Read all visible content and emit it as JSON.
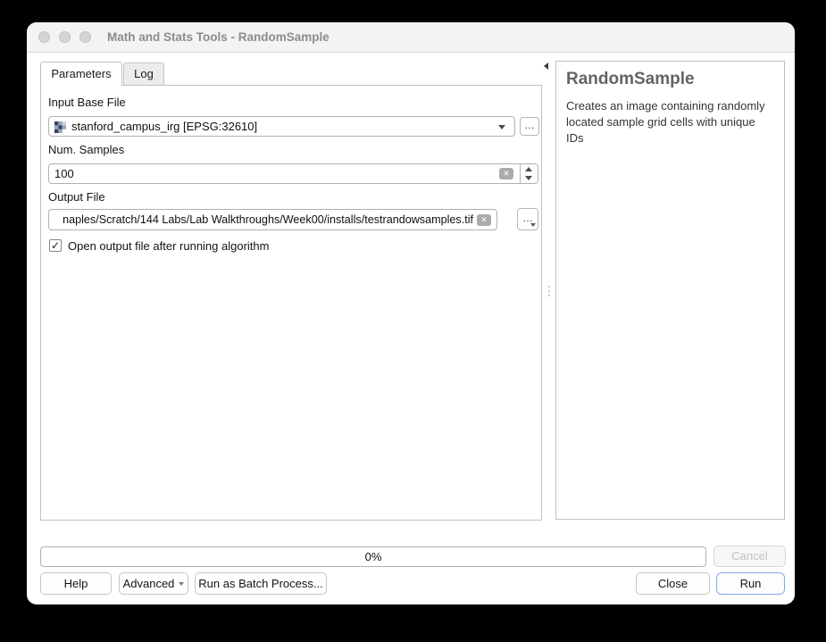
{
  "window": {
    "title": "Math and Stats Tools - RandomSample"
  },
  "tabs": {
    "parameters": "Parameters",
    "log": "Log"
  },
  "form": {
    "input_base_file": {
      "label": "Input Base File",
      "value": "stanford_campus_irg [EPSG:32610]",
      "icon": "raster-layer-icon"
    },
    "num_samples": {
      "label": "Num. Samples",
      "value": "100"
    },
    "output_file": {
      "label": "Output File",
      "value": "naples/Scratch/144 Labs/Lab Walkthroughs/Week00/installs/testrandowsamples.tif"
    },
    "open_output": {
      "label": "Open output file after running algorithm",
      "checked": true
    }
  },
  "help_panel": {
    "title": "RandomSample",
    "description": "Creates an image containing randomly located sample grid cells with unique IDs"
  },
  "progress": {
    "label": "0%"
  },
  "footer": {
    "cancel": "Cancel",
    "help": "Help",
    "advanced": "Advanced",
    "run_batch": "Run as Batch Process...",
    "close": "Close",
    "run": "Run"
  },
  "icons": {
    "check": "✓",
    "ellipsis": "…",
    "clear": "✕"
  },
  "colors": {
    "accent_blue": "#7fabe8",
    "panel_border": "#c0c0c0",
    "title_text": "#8c8c8c",
    "disabled_text": "#c2c2c2",
    "raster_dark": "#35425a",
    "raster_light": "#96a6bd"
  }
}
